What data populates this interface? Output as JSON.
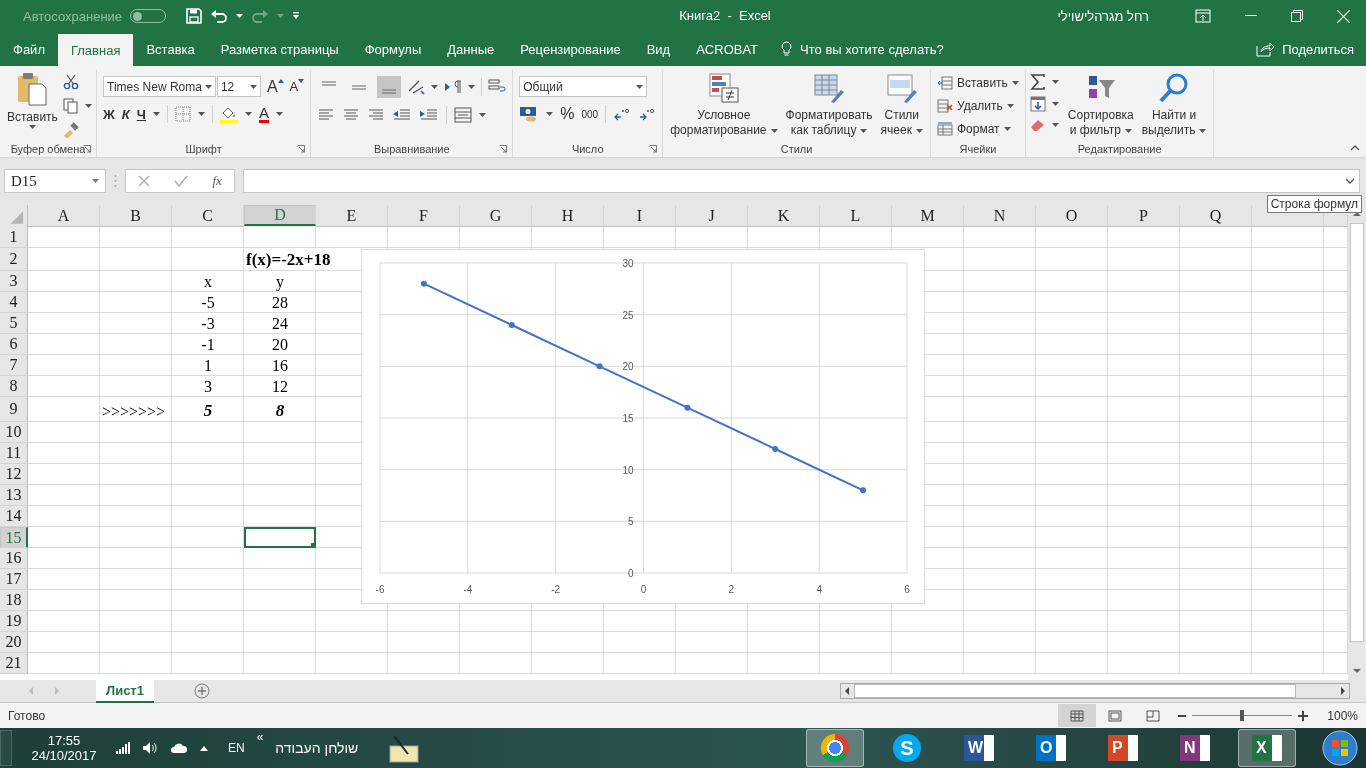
{
  "title_bar": {
    "autosave_label": "Автосохранение",
    "autosave_on": false,
    "title": "Книга2  -  Excel",
    "user": "רחל מגרהלישוילי"
  },
  "tabs": [
    {
      "label": "Файл",
      "selected": false
    },
    {
      "label": "Главная",
      "selected": true
    },
    {
      "label": "Вставка",
      "selected": false
    },
    {
      "label": "Разметка страницы",
      "selected": false
    },
    {
      "label": "Формулы",
      "selected": false
    },
    {
      "label": "Данные",
      "selected": false
    },
    {
      "label": "Рецензирование",
      "selected": false
    },
    {
      "label": "Вид",
      "selected": false
    },
    {
      "label": "ACROBAT",
      "selected": false
    }
  ],
  "tell_me": {
    "placeholder": "Что вы хотите сделать?"
  },
  "share": "Поделиться",
  "ribbon": {
    "clipboard": {
      "paste": "Вставить",
      "label": "Буфер обмена"
    },
    "font": {
      "name": "Times New Roma",
      "size": "12",
      "grow": "A",
      "shrink": "A",
      "bold": "Ж",
      "italic": "К",
      "underline": "Ч",
      "font_color": "A",
      "label": "Шрифт"
    },
    "alignment": {
      "label": "Выравнивание"
    },
    "number": {
      "format": "Общий",
      "percent": "%",
      "thousands": "000",
      "label": "Число"
    },
    "styles": {
      "buttons": [
        {
          "kind": "conditional",
          "lines": [
            "Условное",
            "форматирование"
          ]
        },
        {
          "kind": "table",
          "lines": [
            "Форматировать",
            "как таблицу"
          ]
        },
        {
          "kind": "cell_styles",
          "lines": [
            "Стили",
            "ячеек"
          ]
        }
      ],
      "label": "Стили"
    },
    "cells": {
      "items": [
        {
          "kind": "insert",
          "label": "Вставить"
        },
        {
          "kind": "delete",
          "label": "Удалить"
        },
        {
          "kind": "format",
          "label": "Формат"
        }
      ],
      "label": "Ячейки"
    },
    "editing": {
      "buttons": [
        {
          "kind": "sort",
          "lines": [
            "Сортировка",
            "и фильтр"
          ]
        },
        {
          "kind": "find",
          "lines": [
            "Найти и",
            "выделить"
          ]
        }
      ],
      "label": "Редактирование"
    }
  },
  "formula_bar": {
    "name_box": "D15",
    "fx": "fx",
    "tooltip": "Строка формул"
  },
  "sheet": {
    "columns": [
      {
        "label": "A",
        "selected": false
      },
      {
        "label": "B",
        "selected": false
      },
      {
        "label": "C",
        "selected": false
      },
      {
        "label": "D",
        "selected": true
      },
      {
        "label": "E",
        "selected": false
      },
      {
        "label": "F",
        "selected": false
      },
      {
        "label": "G",
        "selected": false
      },
      {
        "label": "H",
        "selected": false
      },
      {
        "label": "I",
        "selected": false
      },
      {
        "label": "J",
        "selected": false
      },
      {
        "label": "K",
        "selected": false
      },
      {
        "label": "L",
        "selected": false
      },
      {
        "label": "M",
        "selected": false
      },
      {
        "label": "N",
        "selected": false
      },
      {
        "label": "O",
        "selected": false
      },
      {
        "label": "P",
        "selected": false
      },
      {
        "label": "Q",
        "selected": false
      }
    ],
    "rows": [
      {
        "label": "1",
        "selected": false
      },
      {
        "label": "2",
        "selected": false
      },
      {
        "label": "3",
        "selected": false
      },
      {
        "label": "4",
        "selected": false
      },
      {
        "label": "5",
        "selected": false
      },
      {
        "label": "6",
        "selected": false
      },
      {
        "label": "7",
        "selected": false
      },
      {
        "label": "8",
        "selected": false
      },
      {
        "label": "9",
        "selected": false
      },
      {
        "label": "10",
        "selected": false
      },
      {
        "label": "11",
        "selected": false
      },
      {
        "label": "12",
        "selected": false
      },
      {
        "label": "13",
        "selected": false
      },
      {
        "label": "14",
        "selected": false
      },
      {
        "label": "15",
        "selected": true
      },
      {
        "label": "16",
        "selected": false
      },
      {
        "label": "17",
        "selected": false
      },
      {
        "label": "18",
        "selected": false
      },
      {
        "label": "19",
        "selected": false
      },
      {
        "label": "20",
        "selected": false
      },
      {
        "label": "21",
        "selected": false
      }
    ],
    "table": {
      "title": "f(x)=-2x+18",
      "header": [
        "x",
        "y"
      ],
      "rows": [
        [
          "-5",
          "28"
        ],
        [
          "-3",
          "24"
        ],
        [
          "-1",
          "20"
        ],
        [
          "1",
          "16"
        ],
        [
          "3",
          "12"
        ]
      ],
      "result": {
        "marker": ">>>>>>>",
        "values": [
          "5",
          "8"
        ]
      }
    }
  },
  "chart": {
    "chart_data": {
      "type": "line",
      "x": [
        -5,
        -3,
        -1,
        1,
        3,
        5
      ],
      "series": [
        {
          "color": "#4472c4",
          "marker": true,
          "values": [
            28,
            24,
            20,
            16,
            12,
            8
          ]
        }
      ],
      "xlim": [
        -6,
        6
      ],
      "ylim": [
        0,
        30
      ],
      "xticks": [
        -6,
        -4,
        -2,
        0,
        2,
        4,
        6
      ],
      "yticks": [
        0,
        5,
        10,
        15,
        20,
        25,
        30
      ],
      "grid": true
    }
  },
  "sheet_tabs": [
    {
      "label": "Лист1",
      "selected": true
    }
  ],
  "status_bar": {
    "status": "Готово",
    "views": [
      {
        "kind": "normal",
        "selected": true
      },
      {
        "kind": "page_layout",
        "selected": false
      },
      {
        "kind": "page_break",
        "selected": false
      }
    ],
    "zoom": {
      "level": 0.5,
      "reading": "100%"
    }
  },
  "taskbar": {
    "time": "17:55",
    "date": "24/10/2017",
    "language": "EN",
    "toolbar_chevron": "«",
    "desktop_label": "שולחן העבודה",
    "apps": [
      {
        "kind": "chrome",
        "active": true
      },
      {
        "kind": "round",
        "letter": "S",
        "color": "#00a9f0",
        "active": false
      },
      {
        "kind": "tile",
        "letter": "W",
        "color": "#2b579a",
        "active": false
      },
      {
        "kind": "tile",
        "letter": "O",
        "color": "#0072c6",
        "active": false
      },
      {
        "kind": "tile",
        "letter": "P",
        "color": "#d24726",
        "active": false
      },
      {
        "kind": "tile",
        "letter": "N",
        "color": "#80397b",
        "active": false
      },
      {
        "kind": "tile",
        "letter": "X",
        "color": "#217346",
        "active": true
      }
    ]
  }
}
